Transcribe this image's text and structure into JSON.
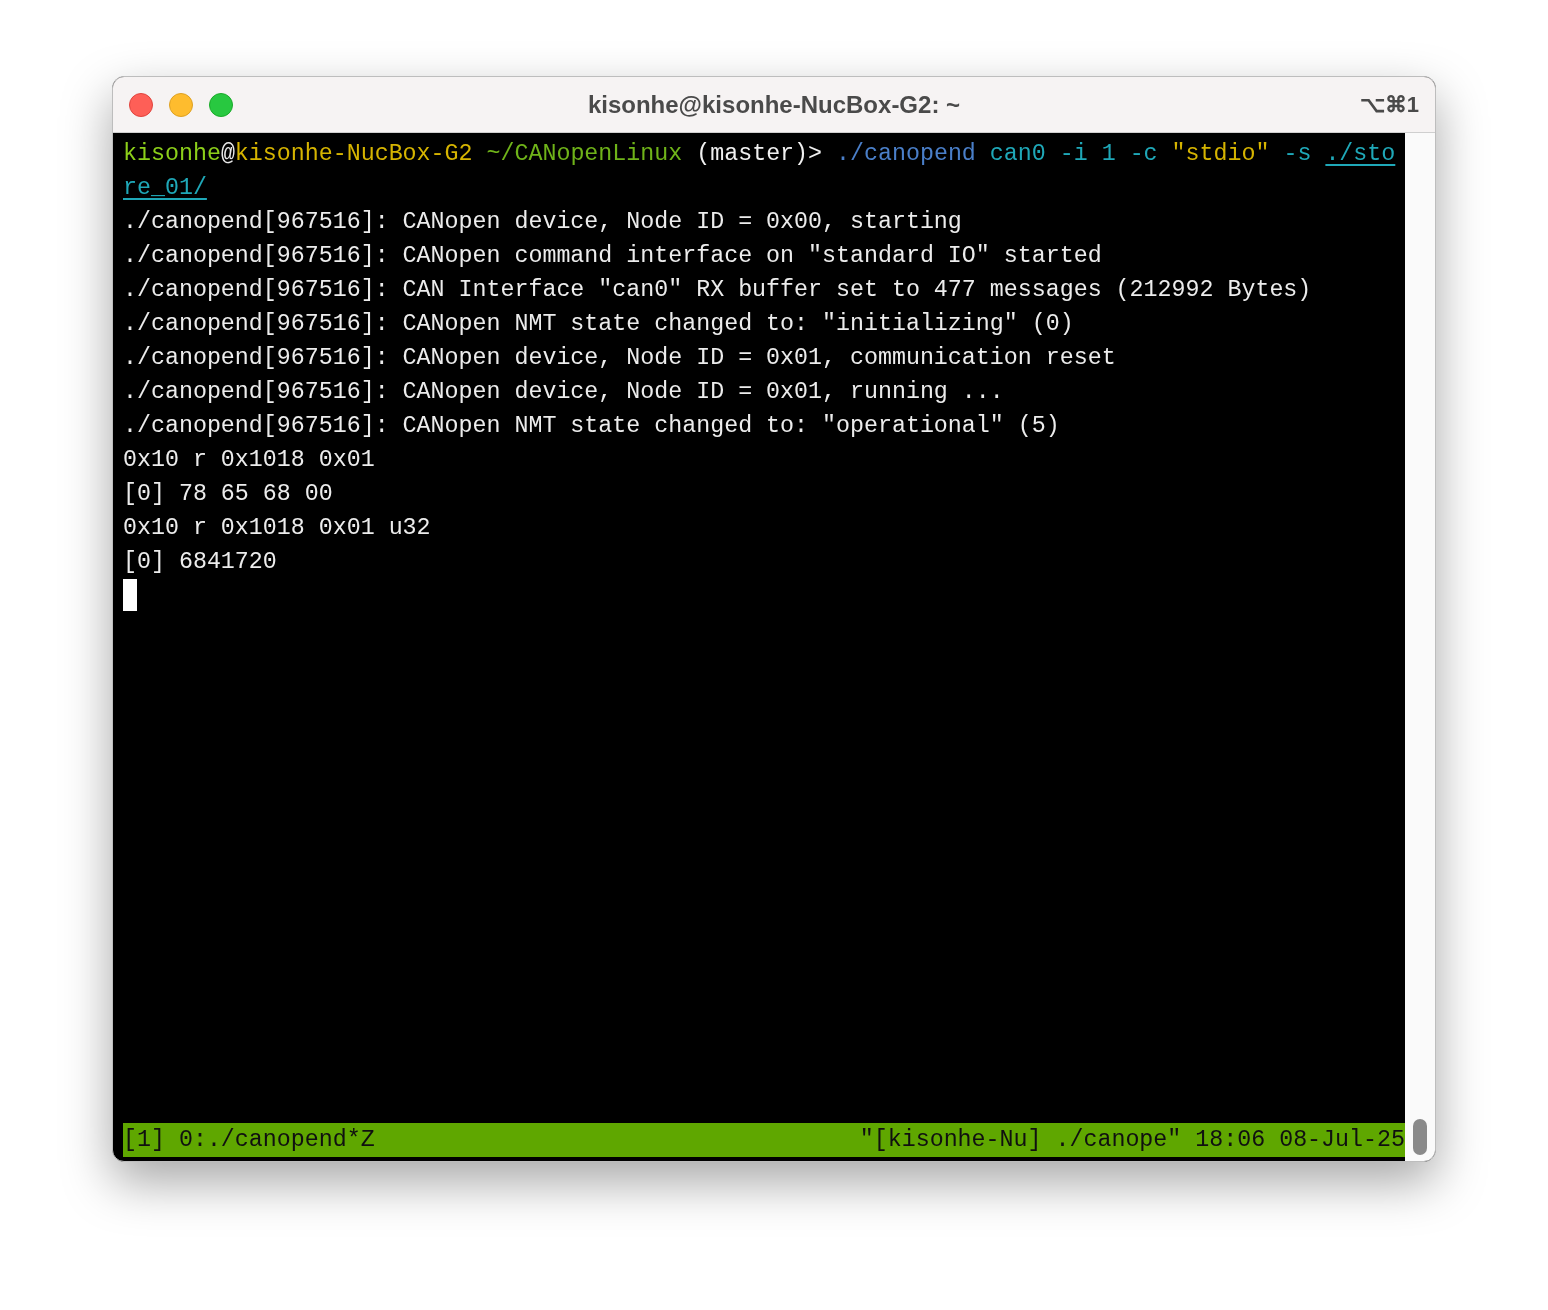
{
  "window": {
    "title": "kisonhe@kisonhe-NucBox-G2: ~",
    "shortcut": "⌥⌘1"
  },
  "prompt": [
    {
      "text": "kisonhe",
      "color": "#8ccf1a",
      "underline": false
    },
    {
      "text": "@",
      "color": "#e8e8e8",
      "underline": false
    },
    {
      "text": "kisonhe-NucBox-G2",
      "color": "#d6b400",
      "underline": false
    },
    {
      "text": " ~/CANopenLinux",
      "color": "#6fb319",
      "underline": false
    },
    {
      "text": " (master)> ",
      "color": "#f0f0f0",
      "underline": false
    },
    {
      "text": "./canopend",
      "color": "#4a7fc9",
      "underline": false
    },
    {
      "text": " can0 -i 1 -c ",
      "color": "#1fa8b8",
      "underline": false
    },
    {
      "text": "\"stdio\"",
      "color": "#d6b400",
      "underline": false
    },
    {
      "text": " -s ",
      "color": "#1fa8b8",
      "underline": false
    },
    {
      "text": "./store_01/",
      "color": "#1fa8b8",
      "underline": true
    }
  ],
  "output": [
    "./canopend[967516]: CANopen device, Node ID = 0x00, starting",
    "./canopend[967516]: CANopen command interface on \"standard IO\" started",
    "./canopend[967516]: CAN Interface \"can0\" RX buffer set to 477 messages (212992 Bytes)",
    "./canopend[967516]: CANopen NMT state changed to: \"initializing\" (0)",
    "./canopend[967516]: CANopen device, Node ID = 0x01, communication reset",
    "./canopend[967516]: CANopen device, Node ID = 0x01, running ...",
    "./canopend[967516]: CANopen NMT state changed to: \"operational\" (5)",
    "0x10 r 0x1018 0x01",
    "[0] 78 65 68 00",
    "0x10 r 0x1018 0x01 u32",
    "[0] 6841720"
  ],
  "status_bar": {
    "left": "[1] 0:./canopend*Z",
    "right": "\"[kisonhe-Nu] ./canope\" 18:06 08-Jul-25"
  }
}
